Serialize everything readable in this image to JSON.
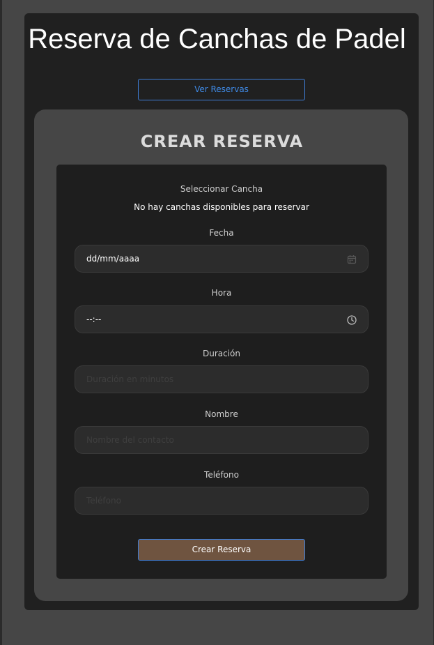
{
  "app": {
    "title": "Reserva de Canchas de Padel"
  },
  "nav": {
    "ver_reservas_label": "Ver Reservas"
  },
  "form": {
    "section_title": "CREAR RESERVA",
    "court_label": "Seleccionar Cancha",
    "no_courts_message": "No hay canchas disponibles para reservar",
    "date": {
      "label": "Fecha",
      "value": "dd/mm/aaaa",
      "icon": "calendar-icon"
    },
    "time": {
      "label": "Hora",
      "value": "--:--",
      "icon": "clock-icon"
    },
    "duration": {
      "label": "Duración",
      "placeholder": "Duración en minutos"
    },
    "name": {
      "label": "Nombre",
      "placeholder": "Nombre del contacto"
    },
    "phone": {
      "label": "Teléfono",
      "placeholder": "Teléfono"
    },
    "submit_label": "Crear Reserva"
  },
  "colors": {
    "page_background": "#464646",
    "card_background": "#202020",
    "form_background": "#1e1e1e",
    "input_background": "#2c2c2c",
    "accent_blue": "#3f8ae6",
    "submit_background": "#6f5440"
  }
}
